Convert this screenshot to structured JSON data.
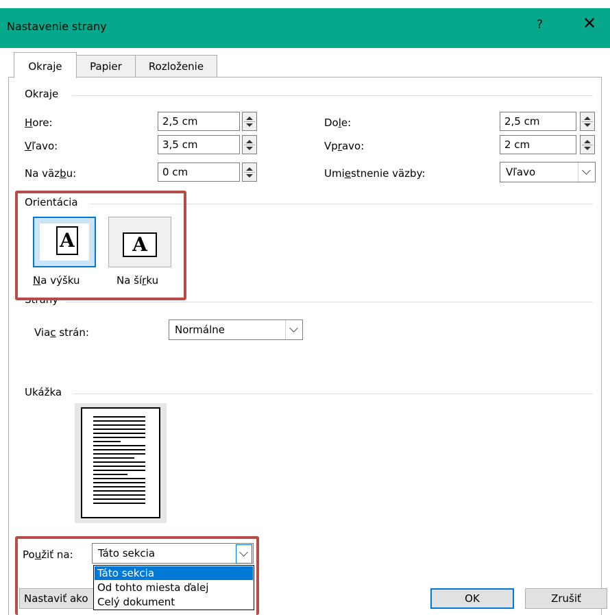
{
  "window": {
    "title": "Nastavenie strany",
    "help_glyph": "?",
    "close_glyph": "✕"
  },
  "tabs": [
    {
      "label": "Okraje",
      "active": true
    },
    {
      "label": "Papier",
      "active": false
    },
    {
      "label": "Rozloženie",
      "active": false
    }
  ],
  "margins": {
    "section": "Okraje",
    "top": {
      "label_pre": "",
      "label_u": "H",
      "label_post": "ore:",
      "value": "2,5 cm"
    },
    "left": {
      "label_pre": "",
      "label_u": "V",
      "label_post": "ľavo:",
      "value": "3,5 cm"
    },
    "gutter": {
      "label_pre": "Na väz",
      "label_u": "b",
      "label_post": "u:",
      "value": "0 cm"
    },
    "bottom": {
      "label_pre": "Do",
      "label_u": "l",
      "label_post": "e:",
      "value": "2,5 cm"
    },
    "right": {
      "label_pre": "Vp",
      "label_u": "r",
      "label_post": "avo:",
      "value": "2 cm"
    },
    "gutter_pos": {
      "label_pre": "Umi",
      "label_u": "e",
      "label_post": "stnenie väzby:",
      "value": "Vľavo"
    }
  },
  "orientation": {
    "section": "Orientácia",
    "portrait": {
      "label_pre": "",
      "label_u": "N",
      "label_post": "a výšku",
      "glyph": "A",
      "selected": true
    },
    "landscape": {
      "label_pre": "Na ší",
      "label_u": "r",
      "label_post": "ku",
      "glyph": "A",
      "selected": false
    }
  },
  "pages": {
    "section": "Strany",
    "multiple_pages": {
      "label_pre": "Via",
      "label_u": "c",
      "label_post": " strán:",
      "value": "Normálne"
    }
  },
  "preview": {
    "section": "Ukážka"
  },
  "apply_to": {
    "label_pre": "Po",
    "label_u": "u",
    "label_post": "žiť na:",
    "value": "Táto sekcia",
    "options": [
      "Táto sekcia",
      "Od tohto miesta ďalej",
      "Celý dokument"
    ],
    "selected_index": 0
  },
  "buttons": {
    "set_default": "Nastaviť ako",
    "ok": "OK",
    "cancel": "Zrušiť"
  },
  "colors": {
    "title_bar": "#05a88a",
    "highlight_box": "#b94a4a",
    "selection": "#0078d7"
  }
}
